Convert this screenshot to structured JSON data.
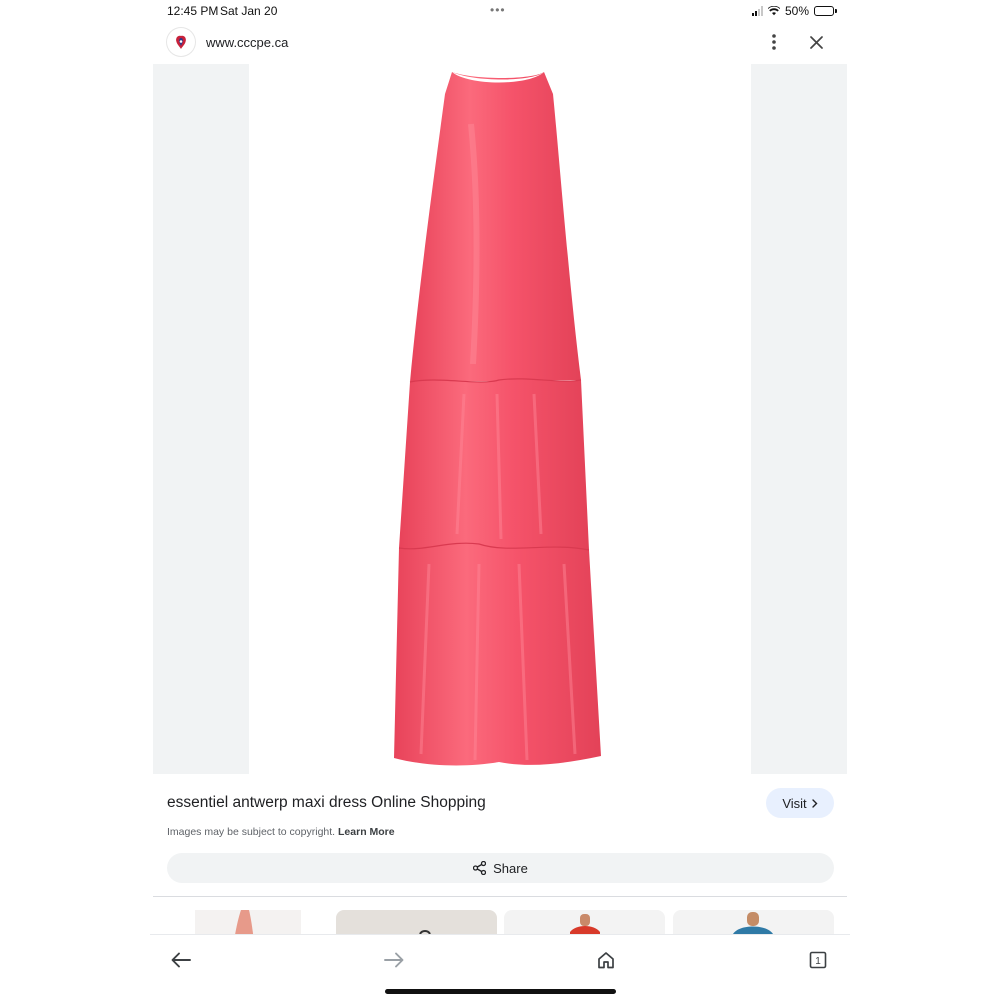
{
  "status_bar": {
    "time": "12:45 PM",
    "date": "Sat Jan 20",
    "dots": "•••",
    "battery_percent": "50%",
    "battery_level": 0.5
  },
  "header": {
    "url": "www.cccpe.ca",
    "favicon_icon": "cccpe-logo-icon",
    "more_icon": "more-vert-icon",
    "close_icon": "close-icon"
  },
  "image": {
    "icon": "product-photo-coral-maxi-dress",
    "dress_color": "#f5536a",
    "side_panel_color": "#f1f3f4"
  },
  "result": {
    "title": "essentiel antwerp maxi dress Online Shopping",
    "visit_label": "Visit",
    "copyright_text": "Images may be subject to copyright.",
    "learn_more_label": "Learn More",
    "share_label": "Share"
  },
  "related": {
    "items": [
      {
        "icon": "related-thumbnail-1",
        "bg": "#f4f2f1"
      },
      {
        "icon": "related-thumbnail-2",
        "bg": "#e4e0db"
      },
      {
        "icon": "related-thumbnail-3",
        "bg": "#f3f3f3"
      },
      {
        "icon": "related-thumbnail-4",
        "bg": "#f3f3f3"
      }
    ]
  },
  "bottom_nav": {
    "back_icon": "arrow-back-icon",
    "forward_icon": "arrow-forward-icon",
    "home_icon": "home-icon",
    "tabs_icon": "tabs-icon",
    "tab_count": "1"
  }
}
